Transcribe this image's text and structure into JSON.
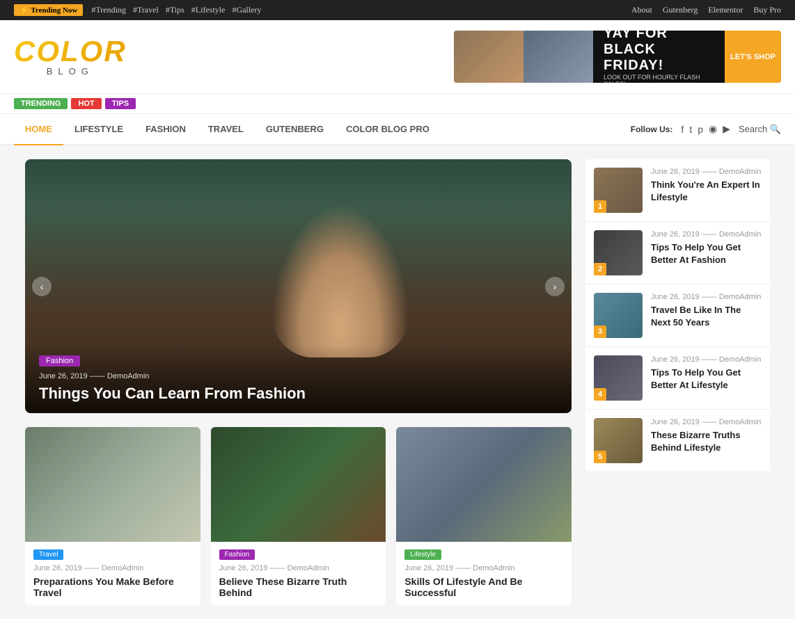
{
  "topbar": {
    "trending_label": "⚡ Trending Now",
    "tags": [
      "#Trending",
      "#Travel",
      "#Tips",
      "#Lifestyle",
      "#Gallery"
    ],
    "right_links": [
      "About",
      "Gutenberg",
      "Elementor",
      "Buy Pro"
    ]
  },
  "header": {
    "logo_text": "COLOR",
    "logo_sub": "BLOG",
    "banner": {
      "headline": "YAY FOR BLACK FRIDAY!",
      "subtext": "LOOK OUT FOR HOURLY FLASH SALES!",
      "cta": "LET'S SHOP"
    }
  },
  "nav_badges": [
    "TRENDING",
    "HOT",
    "TIPS"
  ],
  "nav": {
    "links": [
      "HOME",
      "LIFESTYLE",
      "FASHION",
      "TRAVEL",
      "GUTENBERG",
      "COLOR BLOG PRO"
    ],
    "active": 0,
    "follow_label": "Follow Us:",
    "search_label": "Search"
  },
  "hero": {
    "category": "Fashion",
    "date": "June 26, 2019",
    "author": "DemoAdmin",
    "title": "Things You Can Learn From Fashion"
  },
  "sidebar": {
    "items": [
      {
        "num": "1",
        "date": "June 26, 2019",
        "author": "DemoAdmin",
        "title": "Think You're An Expert In Lifestyle"
      },
      {
        "num": "2",
        "date": "June 26, 2019",
        "author": "DemoAdmin",
        "title": "Tips To Help You Get Better At Fashion"
      },
      {
        "num": "3",
        "date": "June 26, 2019",
        "author": "DemoAdmin",
        "title": "Travel Be Like In The Next 50 Years"
      },
      {
        "num": "4",
        "date": "June 26, 2019",
        "author": "DemoAdmin",
        "title": "Tips To Help You Get Better At Lifestyle"
      },
      {
        "num": "5",
        "date": "June 26, 2019",
        "author": "DemoAdmin",
        "title": "These Bizarre Truths Behind Lifestyle"
      }
    ]
  },
  "cards": [
    {
      "category": "Travel",
      "cat_class": "cat-travel",
      "date": "June 26, 2019",
      "author": "DemoAdmin",
      "title": "Preparations You Make Before Travel",
      "img_class": "card-img-1"
    },
    {
      "category": "Fashion",
      "cat_class": "cat-fashion",
      "date": "June 26, 2019",
      "author": "DemoAdmin",
      "title": "Believe These Bizarre Truth Behind",
      "img_class": "card-img-2"
    },
    {
      "category": "Lifestyle",
      "cat_class": "cat-lifestyle",
      "date": "June 26, 2019",
      "author": "DemoAdmin",
      "title": "Skills Of Lifestyle And Be Successful",
      "img_class": "card-img-3"
    }
  ],
  "social_icons": [
    "f",
    "𝕏",
    "𝒫",
    "📷",
    "▶"
  ]
}
